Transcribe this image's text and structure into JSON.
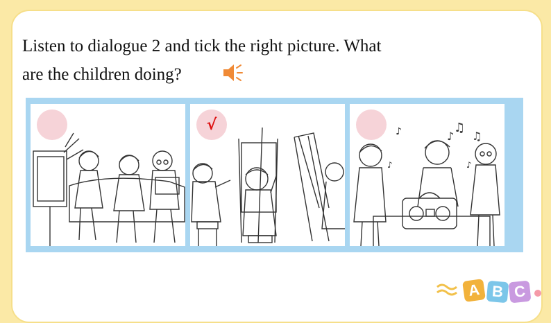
{
  "question": {
    "line1": "Listen to dialogue 2 and tick the right picture. What",
    "line2": "are the children doing?"
  },
  "icons": {
    "speaker": "speaker-icon"
  },
  "panels": [
    {
      "scene": "children-watching-tv",
      "mark": ""
    },
    {
      "scene": "children-painting",
      "mark": "√"
    },
    {
      "scene": "children-singing",
      "mark": ""
    }
  ],
  "decor": {
    "letters": [
      "A",
      "B",
      "C"
    ]
  },
  "colors": {
    "background": "#fbe9a6",
    "frame": "#a9d6f1",
    "circle": "#f6d3d8",
    "tick": "#dd1111"
  }
}
